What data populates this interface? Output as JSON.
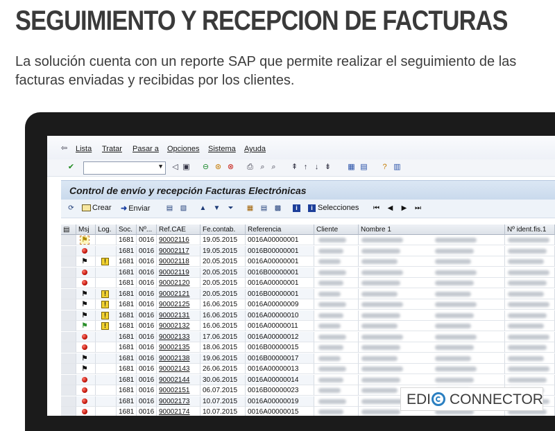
{
  "headline": "SEGUIMIENTO Y RECEPCION DE FACTURAS",
  "subtext": "La solución cuenta con un reporte SAP que permite realizar el seguimiento de las facturas enviadas y recibidas por los clientes.",
  "menu": [
    "Lista",
    "Tratar",
    "Pasar a",
    "Opciones",
    "Sistema",
    "Ayuda"
  ],
  "screen_title": "Control de envío y recepción Facturas Electrónicas",
  "toolbar": {
    "crear": "Crear",
    "enviar": "Enviar",
    "selecciones": "Selecciones"
  },
  "columns": [
    "Msj",
    "Log.",
    "Soc.",
    "Nº...",
    "Ref.CAE",
    "Fe.contab.",
    "Referencia",
    "Cliente",
    "Nombre 1",
    "Nº ident.fis.1"
  ],
  "rows": [
    {
      "msj": "flag-yellow",
      "log": "",
      "soc": "1681",
      "n": "0016",
      "ref": "90002116",
      "fecha": "19.05.2015",
      "referencia": "0016A00000001"
    },
    {
      "msj": "dot-red",
      "log": "",
      "soc": "1681",
      "n": "0016",
      "ref": "90002117",
      "fecha": "19.05.2015",
      "referencia": "0016B00000001"
    },
    {
      "msj": "flag-black",
      "log": "warn",
      "soc": "1681",
      "n": "0016",
      "ref": "90002118",
      "fecha": "20.05.2015",
      "referencia": "0016A00000001"
    },
    {
      "msj": "dot-red",
      "log": "",
      "soc": "1681",
      "n": "0016",
      "ref": "90002119",
      "fecha": "20.05.2015",
      "referencia": "0016B00000001"
    },
    {
      "msj": "dot-red",
      "log": "",
      "soc": "1681",
      "n": "0016",
      "ref": "90002120",
      "fecha": "20.05.2015",
      "referencia": "0016A00000001"
    },
    {
      "msj": "flag-black",
      "log": "warn",
      "soc": "1681",
      "n": "0016",
      "ref": "90002121",
      "fecha": "20.05.2015",
      "referencia": "0016B00000001"
    },
    {
      "msj": "flag-black",
      "log": "warn",
      "soc": "1681",
      "n": "0016",
      "ref": "90002125",
      "fecha": "16.06.2015",
      "referencia": "0016A00000009"
    },
    {
      "msj": "flag-black",
      "log": "warn",
      "soc": "1681",
      "n": "0016",
      "ref": "90002131",
      "fecha": "16.06.2015",
      "referencia": "0016A00000010"
    },
    {
      "msj": "flag-green",
      "log": "warn",
      "soc": "1681",
      "n": "0016",
      "ref": "90002132",
      "fecha": "16.06.2015",
      "referencia": "0016A00000011"
    },
    {
      "msj": "dot-red",
      "log": "",
      "soc": "1681",
      "n": "0016",
      "ref": "90002133",
      "fecha": "17.06.2015",
      "referencia": "0016A00000012"
    },
    {
      "msj": "dot-red",
      "log": "",
      "soc": "1681",
      "n": "0016",
      "ref": "90002135",
      "fecha": "18.06.2015",
      "referencia": "0016B00000015"
    },
    {
      "msj": "flag-black",
      "log": "",
      "soc": "1681",
      "n": "0016",
      "ref": "90002138",
      "fecha": "19.06.2015",
      "referencia": "0016B00000017"
    },
    {
      "msj": "flag-black",
      "log": "",
      "soc": "1681",
      "n": "0016",
      "ref": "90002143",
      "fecha": "26.06.2015",
      "referencia": "0016A00000013"
    },
    {
      "msj": "dot-red",
      "log": "",
      "soc": "1681",
      "n": "0016",
      "ref": "90002144",
      "fecha": "30.06.2015",
      "referencia": "0016A00000014"
    },
    {
      "msj": "dot-red",
      "log": "",
      "soc": "1681",
      "n": "0016",
      "ref": "90002151",
      "fecha": "06.07.2015",
      "referencia": "0016B00000023"
    },
    {
      "msj": "dot-red",
      "log": "",
      "soc": "1681",
      "n": "0016",
      "ref": "90002173",
      "fecha": "10.07.2015",
      "referencia": "0016A00000019"
    },
    {
      "msj": "dot-red",
      "log": "",
      "soc": "1681",
      "n": "0016",
      "ref": "90002174",
      "fecha": "10.07.2015",
      "referencia": "0016A00000015"
    }
  ],
  "logo": {
    "left": "EDI",
    "right": "CONNECTOR"
  },
  "colors": {
    "title_bar": "#c9d9ec",
    "headline": "#3a3a3a",
    "logo_accent": "#2a7fc1",
    "status_red": "#c2150a",
    "warning_yellow": "#f2d230"
  }
}
